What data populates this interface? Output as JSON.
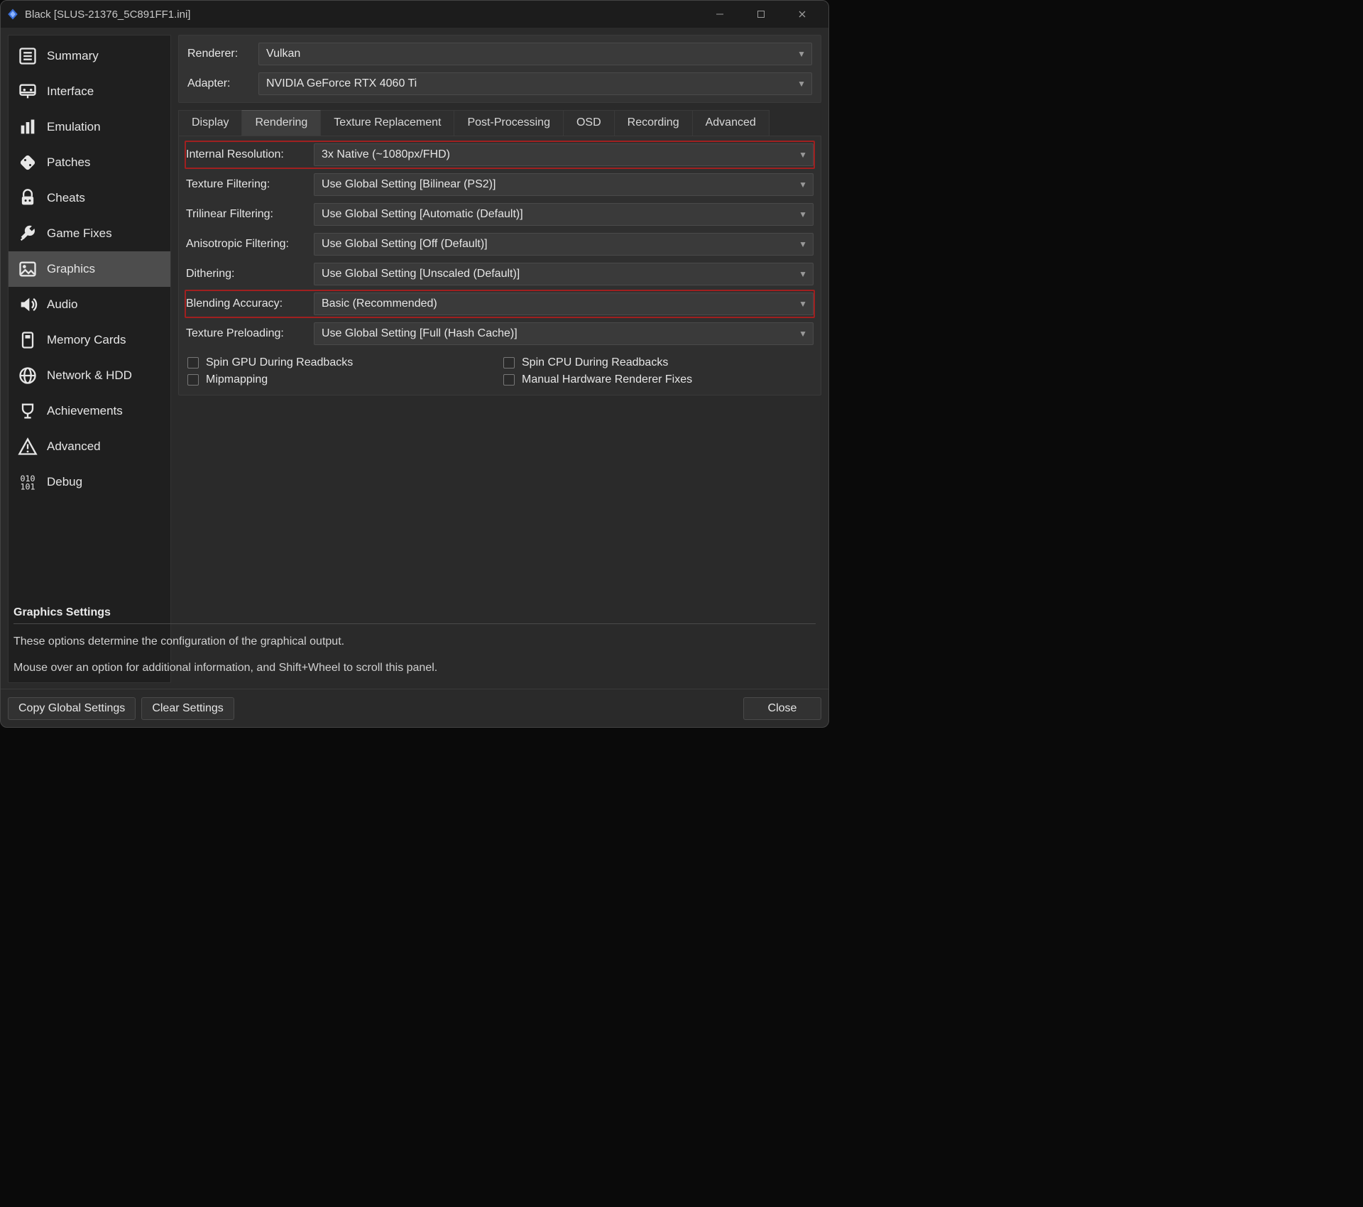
{
  "window": {
    "title": "Black [SLUS-21376_5C891FF1.ini]"
  },
  "sidebar": {
    "items": [
      {
        "label": "Summary",
        "icon": "summary-icon"
      },
      {
        "label": "Interface",
        "icon": "interface-icon"
      },
      {
        "label": "Emulation",
        "icon": "emulation-icon"
      },
      {
        "label": "Patches",
        "icon": "patches-icon"
      },
      {
        "label": "Cheats",
        "icon": "cheats-icon"
      },
      {
        "label": "Game Fixes",
        "icon": "gamefixes-icon"
      },
      {
        "label": "Graphics",
        "icon": "graphics-icon"
      },
      {
        "label": "Audio",
        "icon": "audio-icon"
      },
      {
        "label": "Memory Cards",
        "icon": "memorycards-icon"
      },
      {
        "label": "Network & HDD",
        "icon": "network-icon"
      },
      {
        "label": "Achievements",
        "icon": "achievements-icon"
      },
      {
        "label": "Advanced",
        "icon": "advanced-icon"
      },
      {
        "label": "Debug",
        "icon": "debug-icon"
      }
    ],
    "selected_index": 6
  },
  "top": {
    "renderer_label": "Renderer:",
    "renderer_value": "Vulkan",
    "adapter_label": "Adapter:",
    "adapter_value": "NVIDIA GeForce RTX 4060 Ti"
  },
  "tabs": {
    "items": [
      "Display",
      "Rendering",
      "Texture Replacement",
      "Post-Processing",
      "OSD",
      "Recording",
      "Advanced"
    ],
    "active_index": 1
  },
  "rendering": {
    "rows": [
      {
        "label": "Internal Resolution:",
        "value": "3x Native (~1080px/FHD)",
        "highlight": true
      },
      {
        "label": "Texture Filtering:",
        "value": "Use Global Setting [Bilinear (PS2)]",
        "highlight": false
      },
      {
        "label": "Trilinear Filtering:",
        "value": "Use Global Setting [Automatic (Default)]",
        "highlight": false
      },
      {
        "label": "Anisotropic Filtering:",
        "value": "Use Global Setting [Off (Default)]",
        "highlight": false
      },
      {
        "label": "Dithering:",
        "value": "Use Global Setting [Unscaled (Default)]",
        "highlight": false
      },
      {
        "label": "Blending Accuracy:",
        "value": "Basic (Recommended)",
        "highlight": true
      },
      {
        "label": "Texture Preloading:",
        "value": "Use Global Setting [Full (Hash Cache)]",
        "highlight": false
      }
    ],
    "checks": [
      {
        "label": "Spin GPU During Readbacks",
        "checked": false
      },
      {
        "label": "Spin CPU During Readbacks",
        "checked": false
      },
      {
        "label": "Mipmapping",
        "checked": false
      },
      {
        "label": "Manual Hardware Renderer Fixes",
        "checked": false
      }
    ]
  },
  "help": {
    "title": "Graphics Settings",
    "line1": "These options determine the configuration of the graphical output.",
    "line2": "Mouse over an option for additional information, and Shift+Wheel to scroll this panel."
  },
  "buttons": {
    "copy": "Copy Global Settings",
    "clear": "Clear Settings",
    "close": "Close"
  }
}
